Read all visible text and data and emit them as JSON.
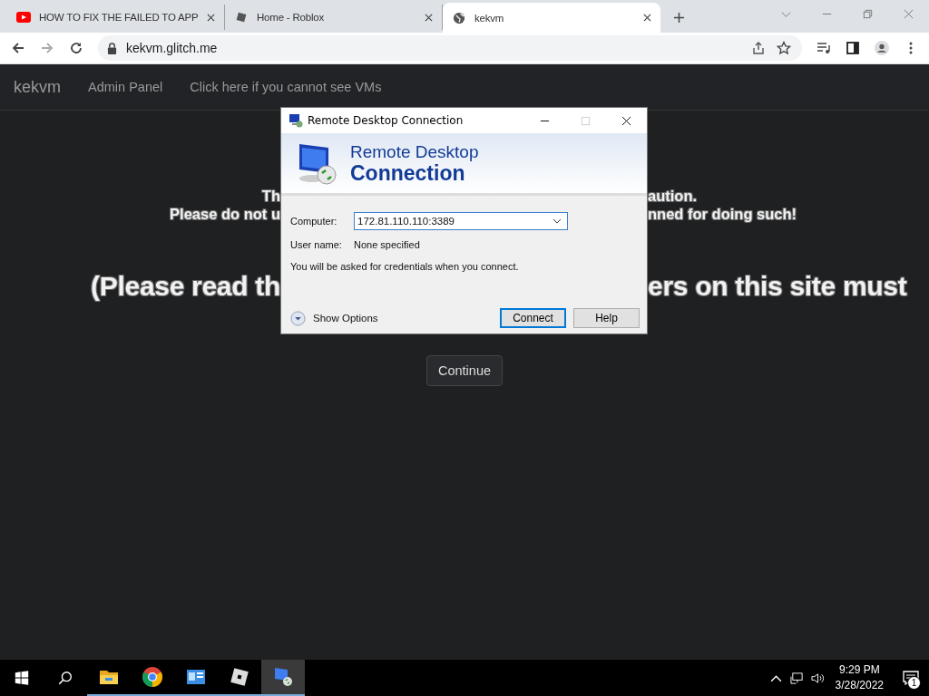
{
  "browser": {
    "tabs": [
      {
        "title": "HOW TO FIX THE FAILED TO APP",
        "kind": "youtube",
        "selected": false
      },
      {
        "title": "Home - Roblox",
        "kind": "roblox",
        "selected": false
      },
      {
        "title": "kekvm",
        "kind": "globe",
        "selected": true
      }
    ],
    "address": "kekvm.glitch.me"
  },
  "navbar": {
    "brand": "kekvm",
    "links": [
      "Admin Panel",
      "Click here if you cannot see VMs"
    ]
  },
  "page": {
    "lines": [
      {
        "kind": "small",
        "left": "Th",
        "right": "aution."
      },
      {
        "kind": "small",
        "left": "Please do not u",
        "right": "nned for doing such!"
      },
      {
        "kind": "big",
        "left": "(Please read th",
        "right": "ers on this site must"
      }
    ],
    "continue_button": "Continue"
  },
  "dialog": {
    "title": "Remote Desktop Connection",
    "heading_line1": "Remote Desktop",
    "heading_line2": "Connection",
    "computer_label": "Computer:",
    "computer_value": "172.81.110.110:3389",
    "username_label": "User name:",
    "username_value": "None specified",
    "info": "You will be asked for credentials when you connect.",
    "show_options": "Show Options",
    "buttons": [
      {
        "label": "Connect",
        "default": true
      },
      {
        "label": "Help",
        "default": false
      }
    ]
  },
  "taskbar": {
    "apps": [
      {
        "kind": "explorer",
        "active": false
      },
      {
        "kind": "chrome",
        "active": false
      },
      {
        "kind": "control-panel",
        "active": false
      },
      {
        "kind": "roblox",
        "active": false
      },
      {
        "kind": "rdp",
        "active": true
      }
    ],
    "time": "9:29 PM",
    "date": "3/28/2022",
    "notification_count": "1"
  }
}
